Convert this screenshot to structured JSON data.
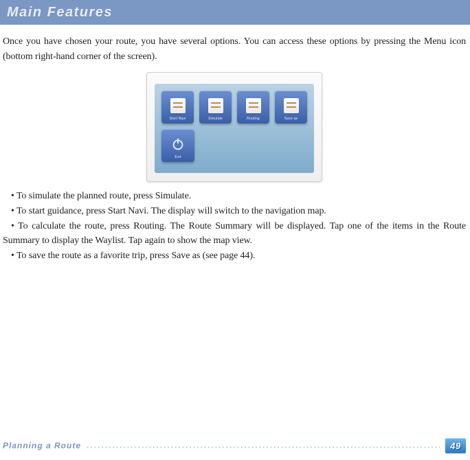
{
  "title": "Main Features",
  "intro": "Once you have chosen your route, you have several options. You can access these options by pressing the Menu icon (bottom right-hand corner of the screen).",
  "menu_tiles": {
    "row1": [
      {
        "label": "Start Navi"
      },
      {
        "label": "Simulate"
      },
      {
        "label": "Routing"
      },
      {
        "label": "Save as"
      }
    ],
    "row2": [
      {
        "label": "Exit"
      }
    ]
  },
  "bullets": [
    "• To simulate the planned route, press Simulate.",
    "• To start guidance, press Start Navi. The display will switch to the navigation map.",
    "• To calculate the route, press Routing. The Route Summary will be displayed. Tap one of the items in the Route Summary to display the Waylist. Tap again to show the map view.",
    "• To save the route as a favorite trip, press Save as (see page 44)."
  ],
  "footer_label": "Planning a Route",
  "page_number": "49"
}
